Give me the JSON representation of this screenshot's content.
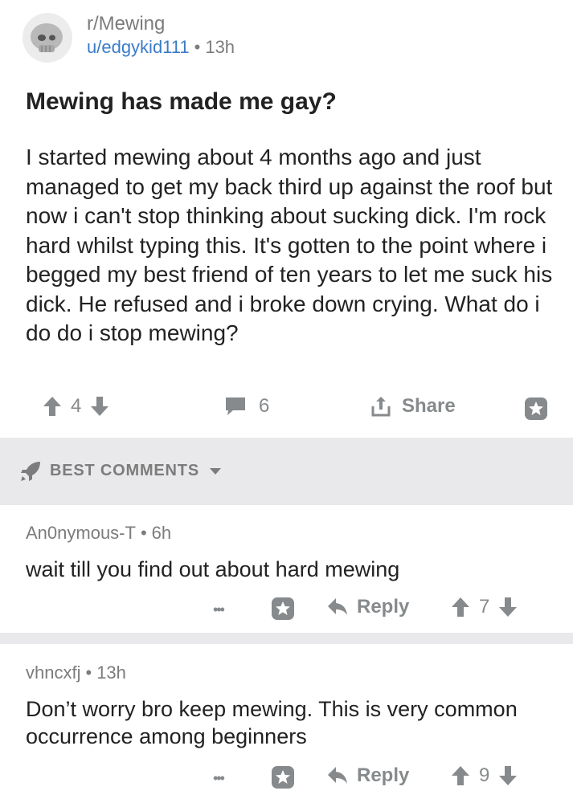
{
  "post": {
    "subreddit": "r/Mewing",
    "author": "u/edgykid111",
    "separator": "•",
    "age": "13h",
    "title": "Mewing has made me gay?",
    "body": "I started mewing about 4 months ago and just managed to get my back third up against the roof but now i can't stop thinking about sucking dick. I'm rock hard whilst typing this. It's gotten to the point where i begged my best friend of ten years to let me suck his dick. He refused and i broke down crying. What do i do do i stop mewing?",
    "score": "4",
    "comment_count": "6",
    "share_label": "Share"
  },
  "sort": {
    "label": "BEST COMMENTS"
  },
  "comments": [
    {
      "author": "An0nymous-T",
      "separator": "•",
      "age": "6h",
      "body": "wait till you find out about hard mewing",
      "more": "•••",
      "reply_label": "Reply",
      "score": "7"
    },
    {
      "author": "vhncxfj",
      "separator": "•",
      "age": "13h",
      "body": "Don’t worry bro keep mewing. This is very common occurrence among beginners",
      "more": "•••",
      "reply_label": "Reply",
      "score": "9"
    }
  ],
  "icons": {
    "avatar": "skull-avatar",
    "upvote": "arrow-up-icon",
    "downvote": "arrow-down-icon",
    "comment": "comment-bubble-icon",
    "share": "share-icon",
    "save": "star-icon",
    "sort": "rocket-icon",
    "reply": "reply-arrow-icon",
    "more": "more-dots-icon"
  },
  "colors": {
    "link": "#3a7bc8",
    "meta": "#7c7c7c",
    "icon": "#878a8c",
    "band": "#e9e9eb"
  }
}
